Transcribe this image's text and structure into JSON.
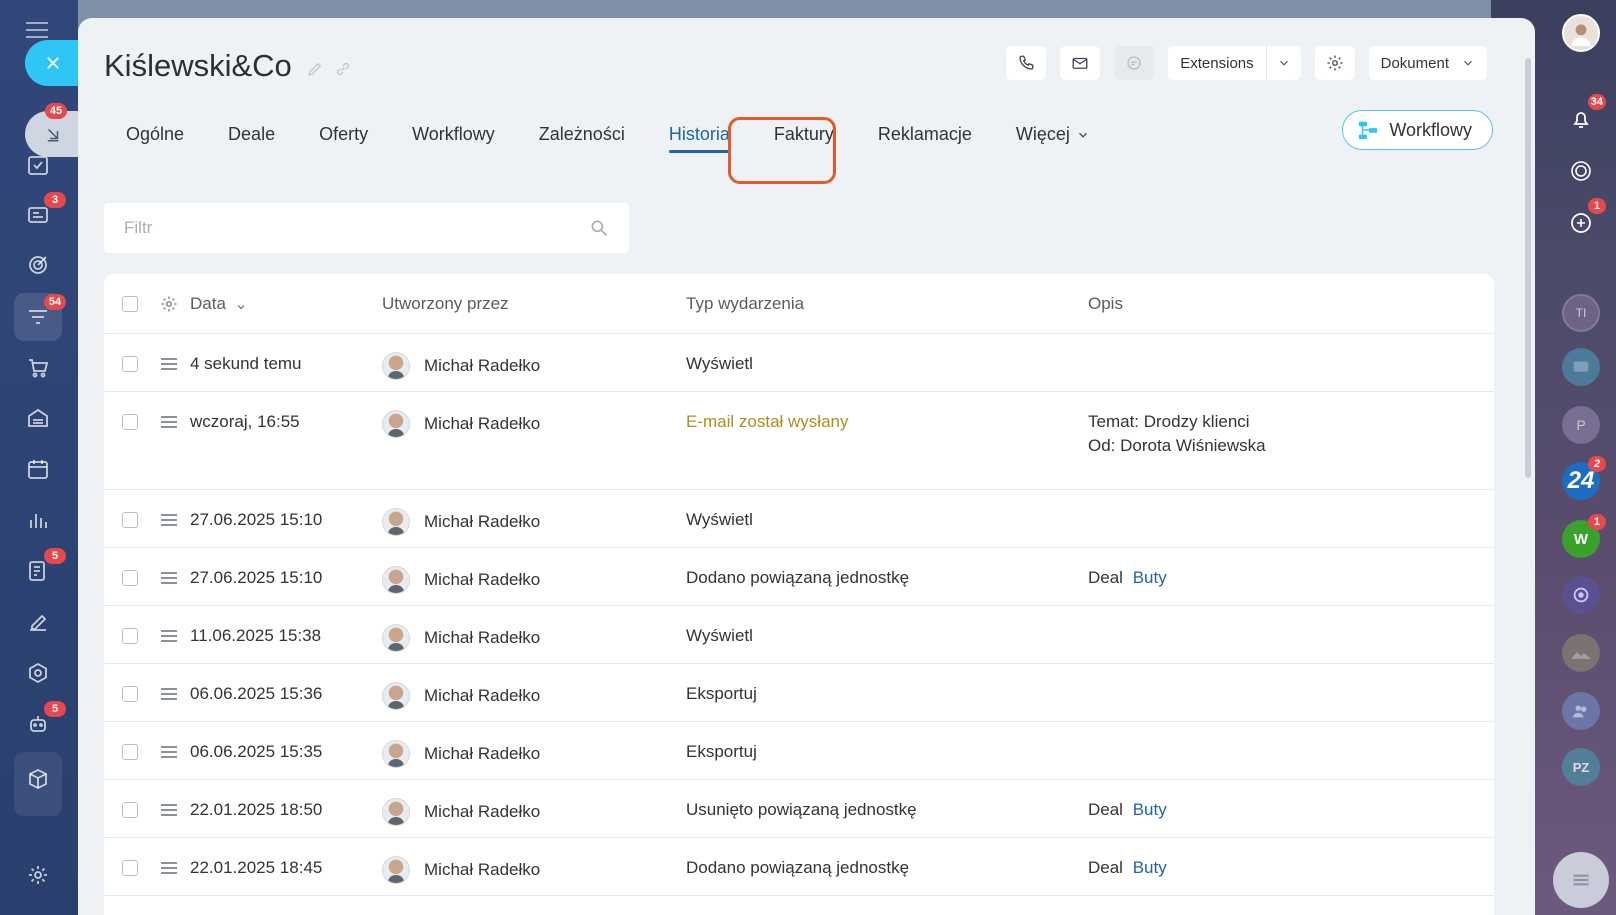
{
  "left_sidebar": {
    "badges": {
      "collapse": "45",
      "cards": "3",
      "funnel": "54",
      "forms": "5",
      "robot": "5"
    }
  },
  "right_sidebar": {
    "badges": {
      "notifications": "34",
      "chat": "1",
      "app24": "2",
      "w": "1"
    },
    "labels": {
      "ti": "TI",
      "p": "P",
      "app24": "24",
      "w": "W",
      "pz": "PZ"
    }
  },
  "header": {
    "title": "Kiślewski&Co",
    "extensions_label": "Extensions",
    "document_label": "Dokument"
  },
  "tabs": [
    {
      "label": "Ogólne"
    },
    {
      "label": "Deale"
    },
    {
      "label": "Oferty"
    },
    {
      "label": "Workflowy"
    },
    {
      "label": "Zależności"
    },
    {
      "label": "Historia"
    },
    {
      "label": "Faktury"
    },
    {
      "label": "Reklamacje"
    },
    {
      "label": "Więcej"
    }
  ],
  "workflows_button": "Workflowy",
  "filter": {
    "placeholder": "Filtr",
    "value": ""
  },
  "table": {
    "columns": {
      "date": "Data",
      "created_by": "Utworzony przez",
      "event_type": "Typ wydarzenia",
      "description": "Opis"
    },
    "rows": [
      {
        "date": "4 sekund temu",
        "user": "Michał Radełko",
        "type": "Wyświetl",
        "desc1": "",
        "desc2": "",
        "desc_link": ""
      },
      {
        "date": "wczoraj, 16:55",
        "user": "Michał Radełko",
        "type": "E-mail został wysłany",
        "desc1": "Temat: Drodzy klienci",
        "desc2": "Od: Dorota Wiśniewska",
        "desc_link": ""
      },
      {
        "date": "27.06.2025 15:10",
        "user": "Michał Radełko",
        "type": "Wyświetl",
        "desc1": "",
        "desc2": "",
        "desc_link": ""
      },
      {
        "date": "27.06.2025 15:10",
        "user": "Michał Radełko",
        "type": "Dodano powiązaną jednostkę",
        "desc1": "Deal",
        "desc2": "",
        "desc_link": "Buty"
      },
      {
        "date": "11.06.2025 15:38",
        "user": "Michał Radełko",
        "type": "Wyświetl",
        "desc1": "",
        "desc2": "",
        "desc_link": ""
      },
      {
        "date": "06.06.2025 15:36",
        "user": "Michał Radełko",
        "type": "Eksportuj",
        "desc1": "",
        "desc2": "",
        "desc_link": ""
      },
      {
        "date": "06.06.2025 15:35",
        "user": "Michał Radełko",
        "type": "Eksportuj",
        "desc1": "",
        "desc2": "",
        "desc_link": ""
      },
      {
        "date": "22.01.2025 18:50",
        "user": "Michał Radełko",
        "type": "Usunięto powiązaną jednostkę",
        "desc1": "Deal",
        "desc2": "",
        "desc_link": "Buty"
      },
      {
        "date": "22.01.2025 18:45",
        "user": "Michał Radełko",
        "type": "Dodano powiązaną jednostkę",
        "desc1": "Deal",
        "desc2": "",
        "desc_link": "Buty"
      }
    ]
  },
  "colors": {
    "accent": "#2fc6f6",
    "active_tab": "#1f63a8",
    "highlight": "#e4582b",
    "email_event": "#b08d1d",
    "badge": "#e5484d"
  }
}
